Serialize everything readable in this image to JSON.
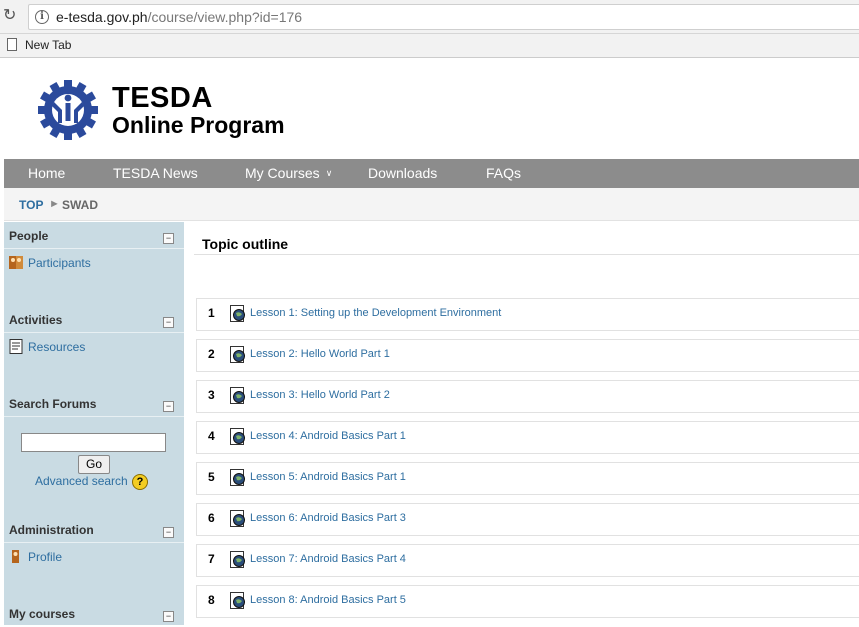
{
  "browser": {
    "url_host": "e-tesda.gov.ph",
    "url_path": "/course/view.php?id=176",
    "bookmark_label": "New Tab"
  },
  "brand": {
    "line1": "TESDA",
    "line2": "Online Program"
  },
  "nav": {
    "home": "Home",
    "news": "TESDA News",
    "courses": "My Courses",
    "downloads": "Downloads",
    "faqs": "FAQs"
  },
  "breadcrumb": {
    "top": "TOP",
    "separator": "►",
    "current": "SWAD"
  },
  "sidebar": {
    "people": {
      "title": "People",
      "link": "Participants"
    },
    "activities": {
      "title": "Activities",
      "link": "Resources"
    },
    "search": {
      "title": "Search Forums",
      "go": "Go",
      "advanced": "Advanced search",
      "help": "?"
    },
    "admin": {
      "title": "Administration",
      "link": "Profile"
    },
    "mycourses": {
      "title": "My courses"
    },
    "collapse_glyph": "−"
  },
  "main": {
    "title": "Topic outline",
    "lessons": [
      {
        "num": "1",
        "label": "Lesson 1: Setting up the Development Environment"
      },
      {
        "num": "2",
        "label": "Lesson 2: Hello World Part 1"
      },
      {
        "num": "3",
        "label": "Lesson 3: Hello World Part 2"
      },
      {
        "num": "4",
        "label": "Lesson 4: Android Basics Part 1"
      },
      {
        "num": "5",
        "label": "Lesson 5: Android Basics Part 1"
      },
      {
        "num": "6",
        "label": "Lesson 6: Android Basics Part 3"
      },
      {
        "num": "7",
        "label": "Lesson 7: Android Basics Part 4"
      },
      {
        "num": "8",
        "label": "Lesson 8: Android Basics Part 5"
      }
    ]
  },
  "colors": {
    "nav_bg": "#8c8c8c",
    "sidebar_bg": "#c9dbe3",
    "link": "#2e6ea0",
    "logo_blue": "#2b4a9c"
  }
}
